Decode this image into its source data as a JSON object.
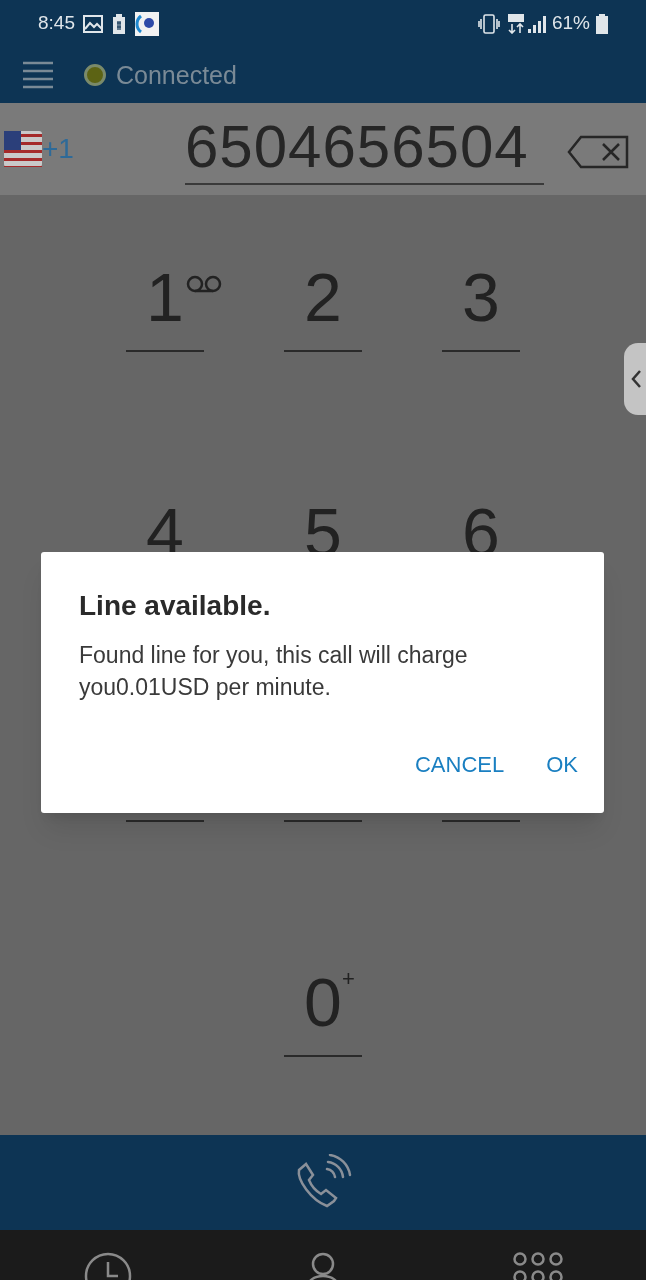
{
  "status_bar": {
    "time": "8:45",
    "battery_text": "61%"
  },
  "app_bar": {
    "status": {
      "label": "Connected",
      "color": "#5c6314"
    }
  },
  "dial_field": {
    "country_code": "+1",
    "value": "6504656504"
  },
  "keypad": [
    {
      "kind": "digit",
      "digit": "1",
      "voicemail": true
    },
    {
      "kind": "digit",
      "digit": "2"
    },
    {
      "kind": "digit",
      "digit": "3"
    },
    {
      "kind": "digit",
      "digit": "4"
    },
    {
      "kind": "digit",
      "digit": "5"
    },
    {
      "kind": "digit",
      "digit": "6"
    },
    {
      "kind": "hidden"
    },
    {
      "kind": "hidden"
    },
    {
      "kind": "hidden"
    },
    {
      "kind": "blank"
    },
    {
      "kind": "digit",
      "digit": "0",
      "sup": "+"
    },
    {
      "kind": "blank"
    }
  ],
  "dialog": {
    "title": "Line available.",
    "message": "Found line for you, this call will charge you0.01USD per minute.",
    "buttons": [
      "CANCEL",
      "OK"
    ]
  }
}
